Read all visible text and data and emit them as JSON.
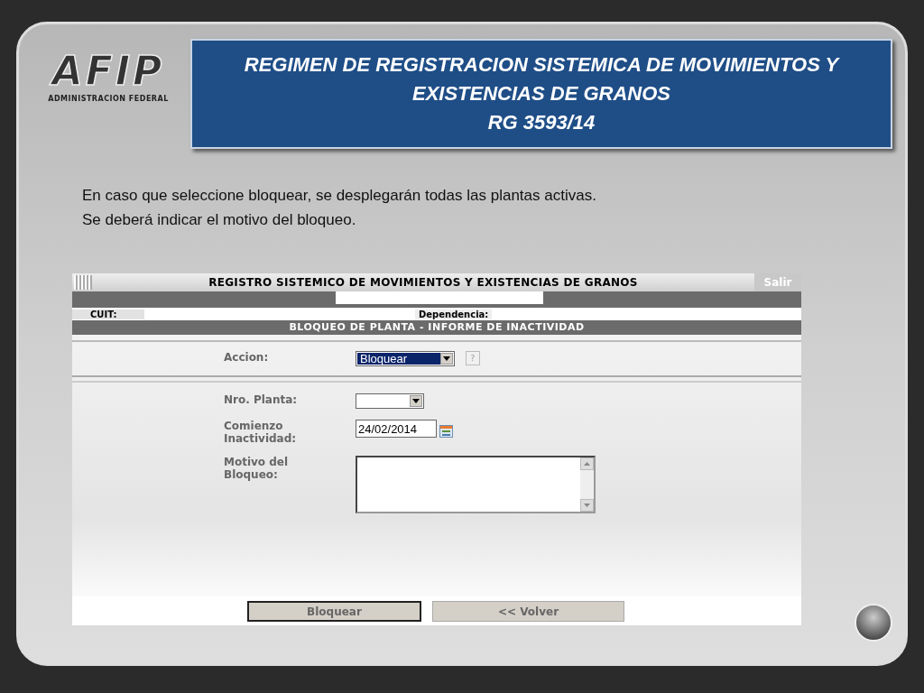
{
  "logo": {
    "mark": "AFIP",
    "subtitle": "ADMINISTRACION FEDERAL"
  },
  "title_lines": [
    "REGIMEN DE REGISTRACION SISTEMICA DE MOVIMIENTOS Y",
    "EXISTENCIAS DE GRANOS",
    "RG  3593/14"
  ],
  "description": [
    "En caso que seleccione bloquear, se desplegarán todas las plantas activas.",
    "Se deberá indicar el motivo del bloqueo."
  ],
  "app": {
    "header": "REGISTRO SISTEMICO DE MOVIMIENTOS Y EXISTENCIAS DE GRANOS",
    "exit_link": "Salir",
    "cuit_label": "CUIT:",
    "dependencia_label": "Dependencia:",
    "section_title": "BLOQUEO DE PLANTA - INFORME DE INACTIVIDAD",
    "fields": [
      {
        "kind": "select",
        "label": "Accion:",
        "value": "Bloquear",
        "highlighted": true,
        "help": "?"
      },
      {
        "kind": "select",
        "label": "Nro. Planta:"
      },
      {
        "kind": "date",
        "label": "Comienzo\nInactividad:",
        "value": "24/02/2014"
      },
      {
        "kind": "textarea",
        "label": "Motivo del\nBloqueo:"
      }
    ],
    "buttons": [
      {
        "label": "Bloquear",
        "focused": true
      },
      {
        "label": "<< Volver",
        "focused": false
      }
    ]
  }
}
